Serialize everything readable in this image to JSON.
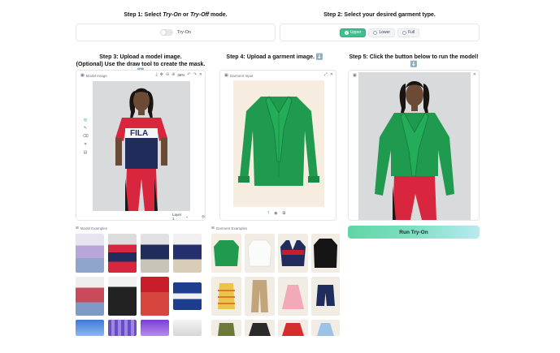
{
  "step1": {
    "prefix": "Step 1: Select ",
    "tryon": "Try-On",
    "mid": " or ",
    "tryoff": "Try-Off",
    "suffix": " mode."
  },
  "step2": {
    "title": "Step 2: Select your desired garment type."
  },
  "mode_toggle": {
    "label": "Try-On"
  },
  "garment_type": {
    "options": [
      "Upper",
      "Lower",
      "Full"
    ],
    "selected": "Upper"
  },
  "step3": {
    "line1": "Step 3: Upload a model image.",
    "line2": "(Optional) Use the draw tool to create the mask. ⬇️"
  },
  "step4": {
    "title": "Step 4: Upload a garment image. ⬇️"
  },
  "step5": {
    "title": "Step 5: Click the button below to run the model! ⬇️"
  },
  "model_panel": {
    "label": "Model Image",
    "zoom": "36%",
    "layer": "Layer 1"
  },
  "garment_panel": {
    "label": "Garment Input"
  },
  "output_panel": {
    "label": "Output Image"
  },
  "run_button": {
    "label": "Run Try-On"
  },
  "model_examples": {
    "label": "Model Examples"
  },
  "garment_examples": {
    "label": "Garment Examples"
  },
  "colors": {
    "accent": "#3fbf8e",
    "garment_green": "#1f9a4e"
  }
}
